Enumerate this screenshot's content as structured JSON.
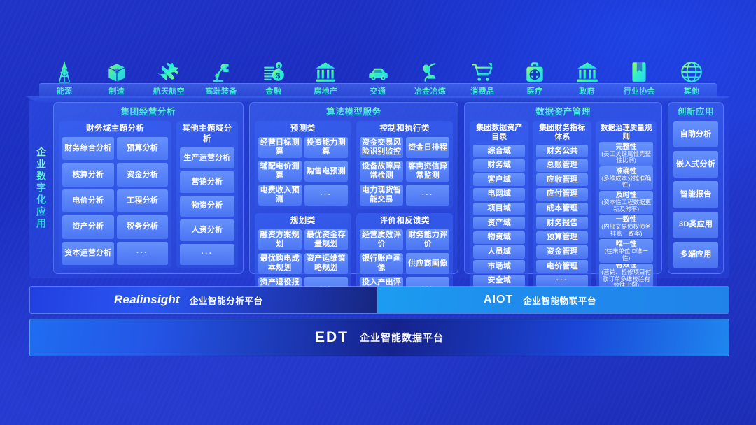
{
  "industries": [
    {
      "label": "能源",
      "icon": "power-tower-icon"
    },
    {
      "label": "制造",
      "icon": "box-package-icon"
    },
    {
      "label": "航天航空",
      "icon": "airplane-icon"
    },
    {
      "label": "高端装备",
      "icon": "robot-arm-icon"
    },
    {
      "label": "金融",
      "icon": "money-coin-icon"
    },
    {
      "label": "房地产",
      "icon": "bank-building-icon"
    },
    {
      "label": "交通",
      "icon": "car-icon"
    },
    {
      "label": "冶金冶炼",
      "icon": "metallurgy-ladle-icon"
    },
    {
      "label": "消费品",
      "icon": "shopping-cart-icon"
    },
    {
      "label": "医疗",
      "icon": "medical-kit-icon"
    },
    {
      "label": "政府",
      "icon": "government-building-icon"
    },
    {
      "label": "行业协会",
      "icon": "book-bookmark-icon"
    },
    {
      "label": "其他",
      "icon": "globe-icon"
    }
  ],
  "side_label": "企业数字化应用",
  "panels": {
    "group_analysis": {
      "title": "集团经营分析",
      "finance": {
        "title": "财务域主题分析",
        "items": [
          "财务综合分析",
          "预算分析",
          "核算分析",
          "资金分析",
          "电价分析",
          "工程分析",
          "资产分析",
          "税务分析",
          "资本运营分析",
          "···"
        ]
      },
      "other": {
        "title": "其他主题域分析",
        "items": [
          "生产运营分析",
          "营销分析",
          "物资分析",
          "人资分析",
          "···"
        ]
      }
    },
    "algorithm": {
      "title": "算法模型服务",
      "forecast": {
        "title": "预测类",
        "items": [
          "经营目标测算",
          "投资能力测算",
          "辅配电价测算",
          "购售电预测",
          "电费收入预测",
          "···"
        ]
      },
      "control": {
        "title": "控制和执行类",
        "items": [
          "资金交易风险识别监控",
          "资金日排程",
          "设备故障异常检测",
          "客商资信异常监测",
          "电力现货智能交易",
          "···"
        ]
      },
      "planning": {
        "title": "规划类",
        "items": [
          "融资方案规划",
          "最优资金存量规划",
          "最优购电成本规划",
          "资产运维策略规划",
          "资产退役报废筹划",
          "···"
        ]
      },
      "evaluation": {
        "title": "评价和反馈类",
        "items": [
          "经营质效评价",
          "财务能力评价",
          "银行账户画像",
          "供应商画像",
          "投入产出评价",
          "···"
        ]
      }
    },
    "data_asset": {
      "title": "数据资产管理",
      "catalog": {
        "title": "集团数据资产目录",
        "items": [
          "综合域",
          "财务域",
          "客户域",
          "电网域",
          "项目域",
          "资产域",
          "物资域",
          "人员域",
          "市场域",
          "安全域"
        ]
      },
      "indicator": {
        "title": "集团财务指标体系",
        "items": [
          "财务公共",
          "总账管理",
          "应收管理",
          "应付管理",
          "成本管理",
          "财务报告",
          "预算管理",
          "资金管理",
          "电价管理",
          "···"
        ]
      },
      "governance": {
        "title": "数据治理质量规则",
        "rules": [
          {
            "name": "完整性",
            "desc": "(员工关键属性完整性比例)"
          },
          {
            "name": "准确性",
            "desc": "(多维成本分摊准确性)"
          },
          {
            "name": "及时性",
            "desc": "(资本性工程数据更新及时率)"
          },
          {
            "name": "一致性",
            "desc": "(内部交易债权债务挂账一致率)"
          },
          {
            "name": "唯一性",
            "desc": "(往来单位ID唯一性)"
          },
          {
            "name": "有效性",
            "desc": "(营销、检修项目付款订单多维校验有效性比例)"
          }
        ]
      }
    },
    "innovation": {
      "title": "创新应用",
      "items": [
        "自助分析",
        "嵌入式分析",
        "智能报告",
        "3D类应用",
        "多端应用"
      ]
    }
  },
  "platforms": {
    "left": {
      "brand": "Realinsight",
      "sub": "企业智能分析平台"
    },
    "right": {
      "brand": "AIOT",
      "sub": "企业智能物联平台"
    },
    "bottom": {
      "brand": "EDT",
      "sub": "企业智能数据平台"
    }
  },
  "colors": {
    "accent_cyan": "#3eeae4",
    "panel_blue": "#4a7cf0",
    "cell_blue": "#6f9cff",
    "bg_blue": "#2134c8"
  }
}
